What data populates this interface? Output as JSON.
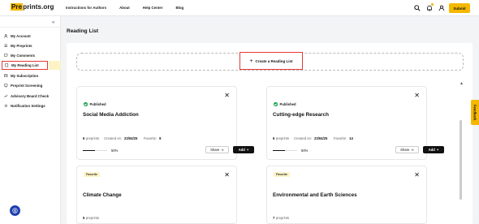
{
  "header": {
    "logo_text": "Preprints.org",
    "logo_pre": "Pre",
    "logo_rest": "prints.org",
    "nav": [
      "Instructions for Authors",
      "About",
      "Help Center",
      "Blog"
    ],
    "submit_label": "Submit",
    "icons": [
      "search-icon",
      "bell-icon",
      "user-icon"
    ]
  },
  "sidebar": {
    "collapse_glyph": "«",
    "items": [
      {
        "label": "My Account",
        "icon": "person-icon"
      },
      {
        "label": "My Preprints",
        "icon": "list-icon"
      },
      {
        "label": "My Comments",
        "icon": "comment-icon"
      },
      {
        "label": "My Reading List",
        "icon": "bookmark-icon",
        "active": true
      },
      {
        "label": "My Subscription",
        "icon": "subscription-icon"
      },
      {
        "label": "Preprint Screening",
        "icon": "screen-icon"
      },
      {
        "label": "Advisory Board Check",
        "icon": "chart-icon"
      },
      {
        "label": "Notification Settings",
        "icon": "gear-icon"
      }
    ]
  },
  "main": {
    "title": "Reading List",
    "create_label": "Create a Reading List",
    "feedback_label": "Feedback"
  },
  "cards": [
    {
      "status": "Published",
      "title": "Social Media Addiction",
      "preprints_count": "6",
      "preprints_label": "preprints",
      "created_label": "Created on:",
      "created_date": "23/04/25",
      "favorites_label": "Favorite:",
      "favorites_count": "8",
      "progress_text": "50%",
      "progress": 0.5,
      "share_label": "Share",
      "add_label": "Add"
    },
    {
      "status": "Published",
      "title": "Cutting-edge Research",
      "preprints_count": "6",
      "preprints_label": "preprints",
      "created_label": "Created on:",
      "created_date": "23/04/25",
      "favorites_label": "Favorite:",
      "favorites_count": "14",
      "progress_text": "50%",
      "progress": 0.5,
      "share_label": "Share",
      "add_label": "Add"
    },
    {
      "tag": "Favorite",
      "title": "Climate Change",
      "preprints_count": "5",
      "preprints_label": "preprints"
    },
    {
      "tag": "Favorite",
      "title": "Environmental and Earth Sciences",
      "preprints_count": "7",
      "preprints_label": "preprints"
    }
  ],
  "colors": {
    "accent": "#f5b800",
    "highlight_border": "#e53935",
    "published": "#16a34a",
    "help_fab": "#1e40af"
  }
}
